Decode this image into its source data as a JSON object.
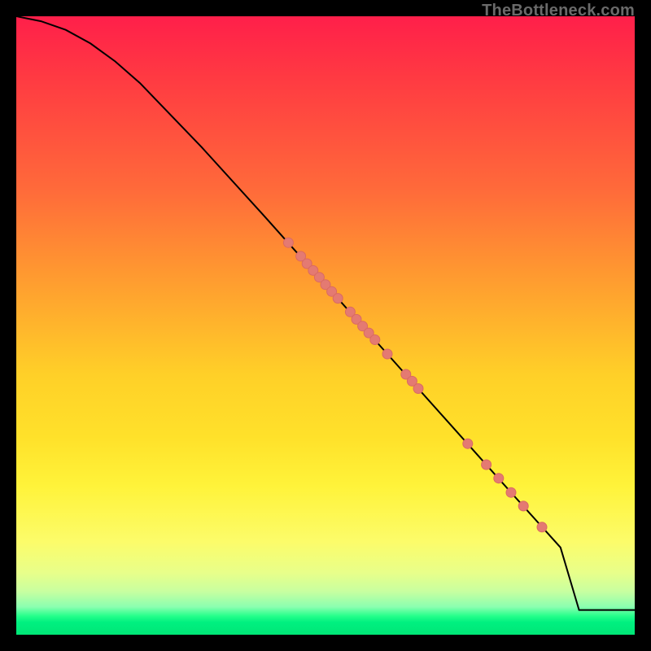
{
  "watermark": "TheBottleneck.com",
  "chart_data": {
    "type": "line",
    "title": "",
    "xlabel": "",
    "ylabel": "",
    "xlim": [
      0,
      100
    ],
    "ylim": [
      0,
      100
    ],
    "grid": false,
    "legend": false,
    "background_gradient": {
      "orientation": "vertical",
      "stops": [
        {
          "pos": 0.0,
          "color": "#ff1f4a"
        },
        {
          "pos": 0.28,
          "color": "#ff6a3a"
        },
        {
          "pos": 0.58,
          "color": "#ffd028"
        },
        {
          "pos": 0.85,
          "color": "#fcfc6a"
        },
        {
          "pos": 0.97,
          "color": "#24ff8a"
        },
        {
          "pos": 1.0,
          "color": "#00e676"
        }
      ]
    },
    "series": [
      {
        "name": "curve",
        "x": [
          0,
          4,
          8,
          12,
          16,
          20,
          30,
          40,
          50,
          60,
          70,
          80,
          88,
          91,
          100
        ],
        "y": [
          100,
          99.2,
          97.8,
          95.6,
          92.7,
          89.2,
          78.8,
          67.8,
          56.6,
          45.4,
          34.2,
          23.0,
          14.1,
          4.0,
          4.0
        ]
      }
    ],
    "points": {
      "name": "markers",
      "x": [
        44,
        46,
        47,
        48,
        49,
        50,
        51,
        52,
        54,
        55,
        56,
        57,
        58,
        60,
        63,
        64,
        65,
        73,
        76,
        78,
        80,
        82,
        85
      ],
      "y": [
        63.4,
        61.2,
        60.0,
        58.9,
        57.8,
        56.6,
        55.5,
        54.4,
        52.2,
        51.0,
        49.9,
        48.8,
        47.7,
        45.4,
        42.1,
        41.0,
        39.8,
        30.9,
        27.5,
        25.3,
        23.0,
        20.8,
        17.4
      ]
    }
  }
}
